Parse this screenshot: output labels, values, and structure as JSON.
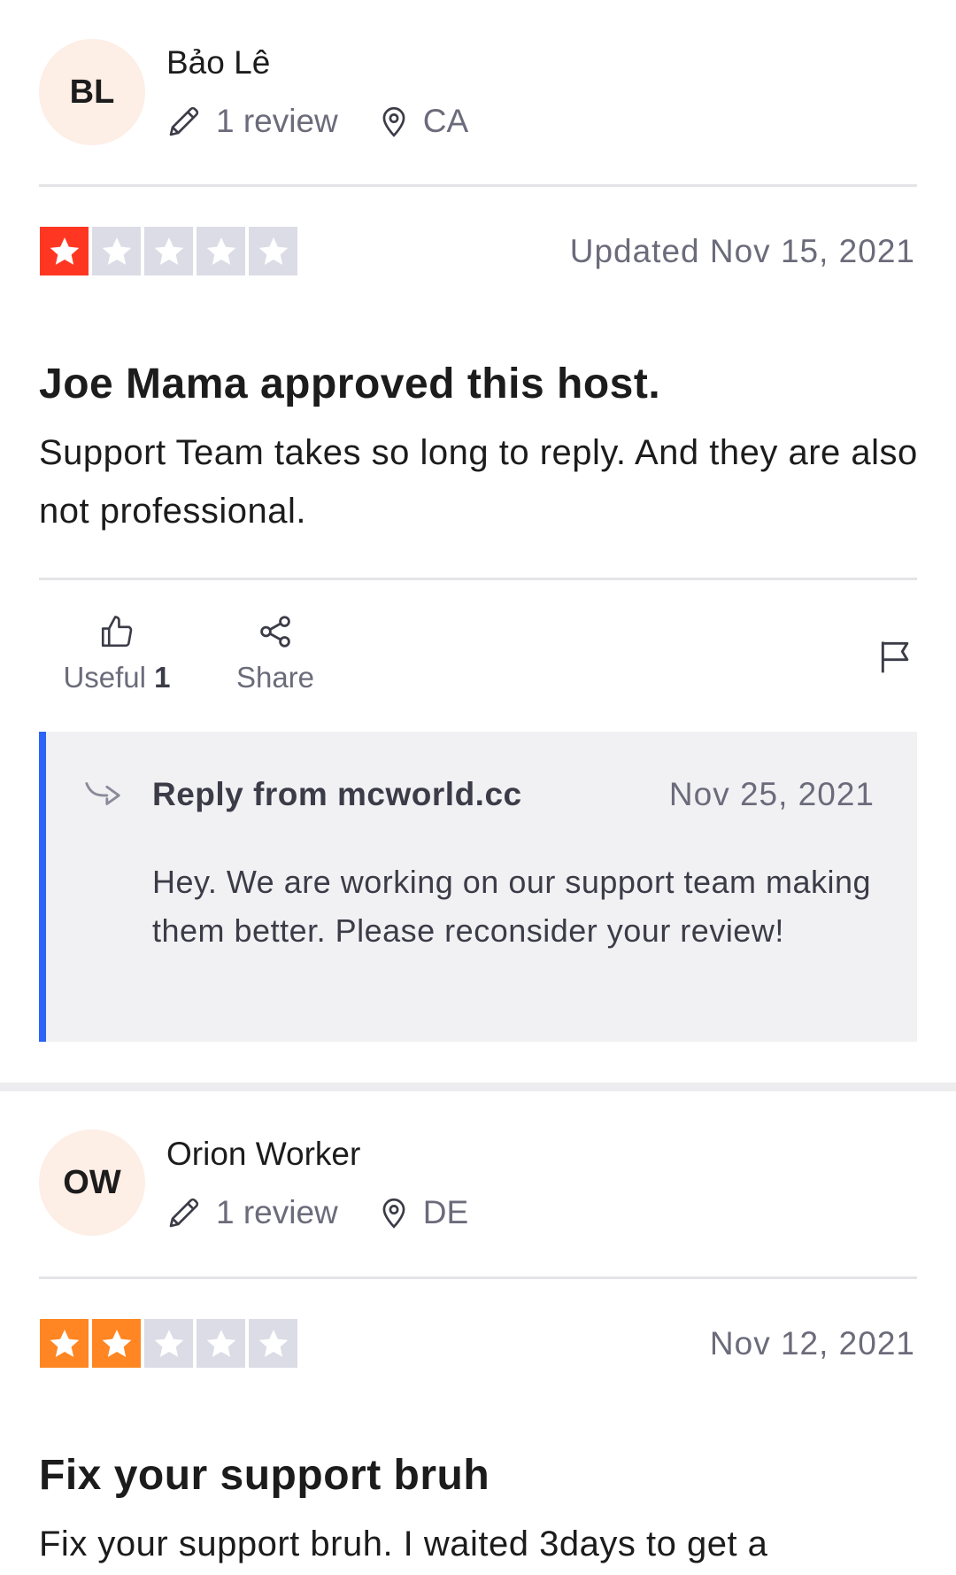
{
  "colors": {
    "star_red": "#ff3722",
    "star_orange": "#ff8622",
    "star_empty": "#dcdce6",
    "reply_accent": "#2a63f5",
    "avatar_bg": "#fdeee6"
  },
  "reviews": [
    {
      "initials": "BL",
      "name": "Bảo Lê",
      "review_count": "1 review",
      "location": "CA",
      "rating": 1,
      "date": "Updated Nov 15, 2021",
      "title": "Joe Mama approved this host.",
      "body": "Support Team takes so long to reply. And they are also not professional.",
      "useful_label": "Useful",
      "useful_count": "1",
      "share_label": "Share",
      "reply": {
        "from": "Reply from mcworld.cc",
        "date": "Nov 25, 2021",
        "text": "Hey. We are working on our support team making them better. Please reconsider your review!"
      }
    },
    {
      "initials": "OW",
      "name": "Orion Worker",
      "review_count": "1 review",
      "location": "DE",
      "rating": 2,
      "date": "Nov 12, 2021",
      "title": "Fix your support bruh",
      "body": "Fix your support bruh. I waited 3days to get a"
    }
  ]
}
